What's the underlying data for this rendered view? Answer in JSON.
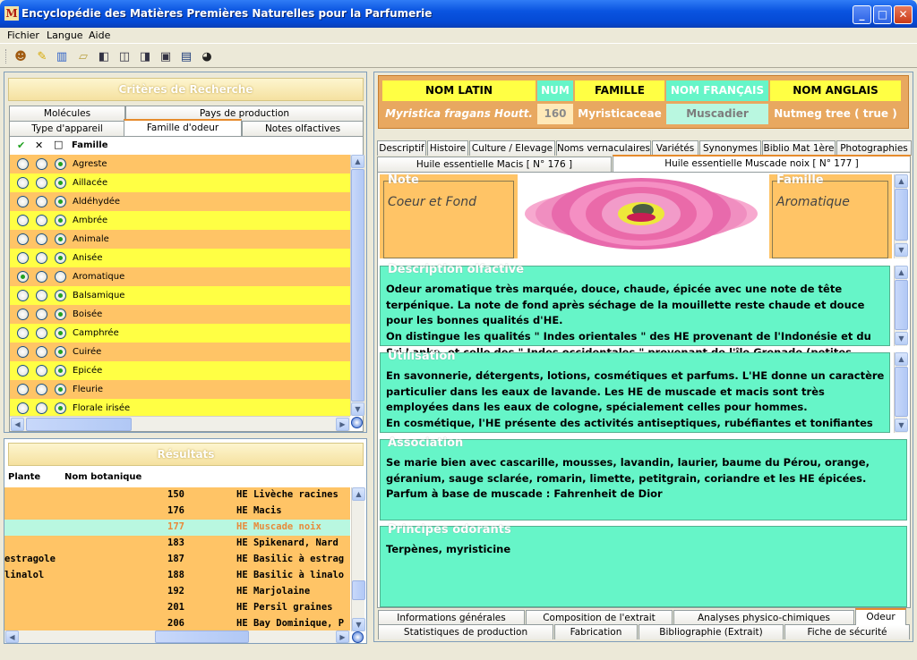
{
  "window": {
    "title": "Encyclopédie des Matières Premières Naturelles pour la Parfumerie",
    "app_icon": "M",
    "min": "_",
    "max": "□",
    "close": "✕"
  },
  "menu": [
    "Fichier",
    "Langue",
    "Aide"
  ],
  "toolbar_icons": [
    "user-icon",
    "pen-icon",
    "book-icon",
    "note-icon",
    "pane-icon",
    "pane-icon",
    "pane-icon",
    "window-icon",
    "globe-icon"
  ],
  "search": {
    "title": "Critères de Recherche",
    "tabs_row1": [
      "Molécules",
      "Pays de production"
    ],
    "tabs_row2": [
      "Type d'appareil",
      "Famille d'odeur",
      "Notes olfactives"
    ],
    "col_check": "✔",
    "col_x": "✕",
    "col_box": "□",
    "col_family": "Famille",
    "families": [
      {
        "name": "Agreste",
        "sel": 2
      },
      {
        "name": "Aillacée",
        "sel": 2
      },
      {
        "name": "Aldéhydée",
        "sel": 2
      },
      {
        "name": "Ambrée",
        "sel": 2
      },
      {
        "name": "Animale",
        "sel": 2
      },
      {
        "name": "Anisée",
        "sel": 2
      },
      {
        "name": "Aromatique",
        "sel": 0
      },
      {
        "name": "Balsamique",
        "sel": 2
      },
      {
        "name": "Boisée",
        "sel": 2
      },
      {
        "name": "Camphrée",
        "sel": 2
      },
      {
        "name": "Cuirée",
        "sel": 2
      },
      {
        "name": "Epicée",
        "sel": 2
      },
      {
        "name": "Fleurie",
        "sel": 2
      },
      {
        "name": "Florale irisée",
        "sel": 2
      }
    ]
  },
  "results": {
    "title": "Résultats",
    "col_plant": "Plante",
    "col_botanic": "Nom botanique",
    "rows": [
      {
        "left": "",
        "num": "150",
        "name": "HE Livèche racines"
      },
      {
        "left": "",
        "num": "176",
        "name": "HE Macis"
      },
      {
        "left": "",
        "num": "177",
        "name": "HE Muscade noix",
        "selected": true
      },
      {
        "left": "",
        "num": "183",
        "name": "HE Spikenard, Nard"
      },
      {
        "left": "estragole",
        "num": "187",
        "name": "HE Basilic à estrag"
      },
      {
        "left": "linalol",
        "num": "188",
        "name": "HE Basilic à linalo"
      },
      {
        "left": "",
        "num": "192",
        "name": "HE Marjolaine"
      },
      {
        "left": "",
        "num": "201",
        "name": "HE Persil graines"
      },
      {
        "left": "",
        "num": "206",
        "name": "HE Bay Dominique, P"
      }
    ]
  },
  "detail": {
    "headers": {
      "latin": "NOM LATIN",
      "num": "NUM",
      "family": "FAMILLE",
      "fr": "NOM FRANÇAIS",
      "en": "NOM ANGLAIS"
    },
    "values": {
      "latin": "Myristica fragans Houtt.",
      "num": "160",
      "family": "Myristicaceae",
      "fr": "Muscadier",
      "en": "Nutmeg tree ( true )"
    },
    "tabs": [
      "Descriptif",
      "Histoire",
      "Culture / Elevage",
      "Noms vernaculaires",
      "Variétés",
      "Synonymes",
      "Biblio Mat 1ère",
      "Photographies"
    ],
    "subtabs": [
      "Huile essentielle Macis [ N° 176 ]",
      "Huile essentielle Muscade noix [ N° 177 ]"
    ],
    "note": {
      "title": "Note",
      "value": "Coeur et Fond"
    },
    "famille": {
      "title": "Famille",
      "value": "Aromatique"
    },
    "description": {
      "title": "Description olfactive",
      "text": "Odeur aromatique très marquée, douce, chaude, épicée avec une note de tête\nterpénique. La note de fond après séchage de la mouillette reste chaude et douce\npour les bonnes qualités d'HE.\nOn distingue les qualités \" Indes orientales \" des HE provenant de l'Indonésie et du\nSri Lanka, et celle des \" Indes occidentales \" provenant de l'île Grenade (petites"
    },
    "utilisation": {
      "title": "Utilisation",
      "text": "En savonnerie, détergents, lotions, cosmétiques et parfums. L'HE donne un caractère\nparticulier dans les eaux de lavande. Les HE de muscade et macis sont très\nemployées dans les eaux de cologne, spécialement celles pour hommes.\nEn cosmétique, l'HE présente des activités antiseptiques, rubéfiantes et tonifiantes"
    },
    "association": {
      "title": "Association",
      "text": "Se marie bien avec cascarille, mousses, lavandin, laurier, baume du Pérou, orange,\ngéranium, sauge sclarée, romarin, limette, petitgrain, coriandre et les HE épicées.\nParfum à base de muscade : Fahrenheit de Dior"
    },
    "principes": {
      "title": "Principes odorants",
      "text": "Terpènes, myristicine"
    },
    "bottom_tabs1": [
      "Informations générales",
      "Composition de l'extrait",
      "Analyses physico-chimiques",
      "Odeur"
    ],
    "bottom_tabs2": [
      "Statistiques de production",
      "Fabrication",
      "Bibliographie (Extrait)",
      "Fiche de sécurité"
    ]
  },
  "colors": {
    "orange": "#ffc466",
    "yellow": "#ffff44",
    "mint": "#66f5c8",
    "selected_row": "#b9f7e0",
    "xp_blue": "#0a54e0"
  }
}
